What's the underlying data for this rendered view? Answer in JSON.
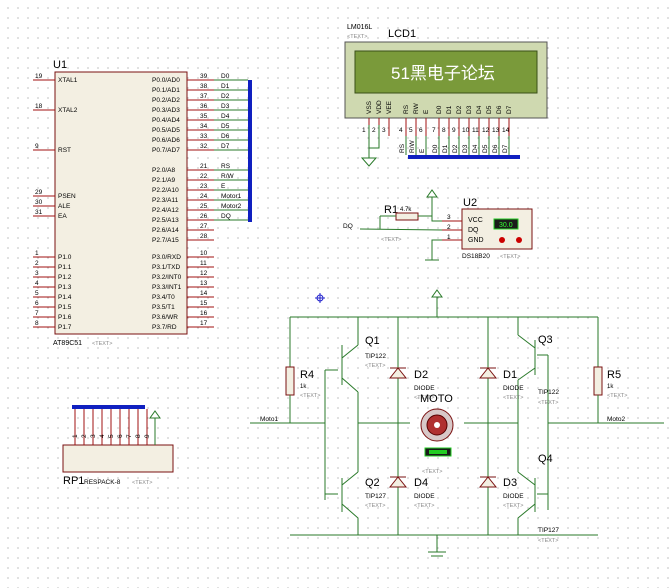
{
  "lcd": {
    "part": "LM016L",
    "ref": "LCD1",
    "placeholder": "<TEXT>",
    "display": "51黑电子论坛",
    "pin_names": [
      "VSS",
      "VDD",
      "VEE",
      "RS",
      "RW",
      "E",
      "D0",
      "D1",
      "D2",
      "D3",
      "D4",
      "D5",
      "D6",
      "D7"
    ],
    "pin_numbers": [
      "1",
      "2",
      "3",
      "4",
      "5",
      "6",
      "7",
      "8",
      "9",
      "10",
      "11",
      "12",
      "13",
      "14"
    ],
    "net_labels": [
      "RS",
      "R/W",
      "E",
      "D0",
      "D1",
      "D2",
      "D3",
      "D4",
      "D5",
      "D6",
      "D7"
    ]
  },
  "mcu": {
    "ref": "U1",
    "part": "AT89C51",
    "placeholder": "<TEXT>",
    "left_pins": [
      {
        "num": "19",
        "name": "XTAL1"
      },
      {
        "num": "18",
        "name": "XTAL2"
      },
      {
        "num": "9",
        "name": "RST"
      },
      {
        "num": "29",
        "name": "PSEN"
      },
      {
        "num": "30",
        "name": "ALE"
      },
      {
        "num": "31",
        "name": "EA"
      },
      {
        "num": "1",
        "name": "P1.0"
      },
      {
        "num": "2",
        "name": "P1.1"
      },
      {
        "num": "3",
        "name": "P1.2"
      },
      {
        "num": "4",
        "name": "P1.3"
      },
      {
        "num": "5",
        "name": "P1.4"
      },
      {
        "num": "6",
        "name": "P1.5"
      },
      {
        "num": "7",
        "name": "P1.6"
      },
      {
        "num": "8",
        "name": "P1.7"
      }
    ],
    "right_pins": [
      {
        "num": "39",
        "name": "P0.0/AD0",
        "net": "D0"
      },
      {
        "num": "38",
        "name": "P0.1/AD1",
        "net": "D1"
      },
      {
        "num": "37",
        "name": "P0.2/AD2",
        "net": "D2"
      },
      {
        "num": "36",
        "name": "P0.3/AD3",
        "net": "D3"
      },
      {
        "num": "35",
        "name": "P0.4/AD4",
        "net": "D4"
      },
      {
        "num": "34",
        "name": "P0.5/AD5",
        "net": "D5"
      },
      {
        "num": "33",
        "name": "P0.6/AD6",
        "net": "D6"
      },
      {
        "num": "32",
        "name": "P0.7/AD7",
        "net": "D7"
      },
      {
        "num": "21",
        "name": "P2.0/A8",
        "net": "RS"
      },
      {
        "num": "22",
        "name": "P2.1/A9",
        "net": "R/W"
      },
      {
        "num": "23",
        "name": "P2.2/A10",
        "net": "E"
      },
      {
        "num": "24",
        "name": "P2.3/A11",
        "net": "Motor1"
      },
      {
        "num": "25",
        "name": "P2.4/A12",
        "net": "Motor2"
      },
      {
        "num": "26",
        "name": "P2.5/A13",
        "net": "DQ"
      },
      {
        "num": "27",
        "name": "P2.6/A14",
        "net": ""
      },
      {
        "num": "28",
        "name": "P2.7/A15",
        "net": ""
      },
      {
        "num": "10",
        "name": "P3.0/RXD",
        "net": ""
      },
      {
        "num": "11",
        "name": "P3.1/TXD",
        "net": ""
      },
      {
        "num": "12",
        "name": "P3.2/INT0",
        "net": ""
      },
      {
        "num": "13",
        "name": "P3.3/INT1",
        "net": ""
      },
      {
        "num": "14",
        "name": "P3.4/T0",
        "net": ""
      },
      {
        "num": "15",
        "name": "P3.5/T1",
        "net": ""
      },
      {
        "num": "16",
        "name": "P3.6/WR",
        "net": ""
      },
      {
        "num": "17",
        "name": "P3.7/RD",
        "net": ""
      }
    ]
  },
  "sensor": {
    "ref": "U2",
    "part": "DS18B20",
    "placeholder": "<TEXT>",
    "vcc": "VCC",
    "dq": "DQ",
    "gnd": "GND",
    "reading": "30.0",
    "pins": [
      "3",
      "2",
      "1"
    ],
    "net": "DQ"
  },
  "r1": {
    "ref": "R1",
    "value": "4.7k",
    "placeholder": "<TEXT>"
  },
  "rp1": {
    "ref": "RP1",
    "part": "RESPACK-8",
    "placeholder": "<TEXT>",
    "pins": [
      "1",
      "2",
      "3",
      "4",
      "5",
      "6",
      "7",
      "8",
      "9"
    ]
  },
  "bridge": {
    "q1": {
      "ref": "Q1",
      "part": "TIP122",
      "placeholder": "<TEXT>"
    },
    "q2": {
      "ref": "Q2",
      "part": "TIP127",
      "placeholder": "<TEXT>"
    },
    "q3": {
      "ref": "Q3",
      "part": "TIP122",
      "placeholder": "<TEXT>"
    },
    "q4": {
      "ref": "Q4",
      "part": "TIP127",
      "placeholder": "<TEXT>"
    },
    "d1": {
      "ref": "D1",
      "part": "DIODE",
      "placeholder": "<TEXT>"
    },
    "d2": {
      "ref": "D2",
      "part": "DIODE",
      "placeholder": "<TEXT>"
    },
    "d3": {
      "ref": "D3",
      "part": "DIODE",
      "placeholder": "<TEXT>"
    },
    "d4": {
      "ref": "D4",
      "part": "DIODE",
      "placeholder": "<TEXT>"
    },
    "r4": {
      "ref": "R4",
      "value": "1k",
      "placeholder": "<TEXT>"
    },
    "r5": {
      "ref": "R5",
      "value": "1k",
      "placeholder": "<TEXT>"
    },
    "motor": {
      "ref": "MOTO",
      "placeholder": "<TEXT>"
    },
    "net_left": "Moto1",
    "net_right": "Moto2"
  }
}
